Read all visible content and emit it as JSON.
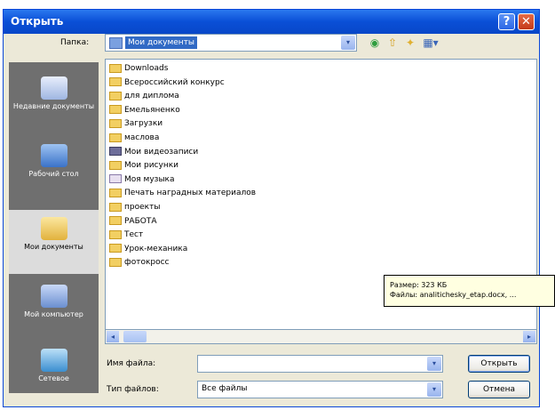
{
  "window": {
    "title": "Открыть",
    "help_glyph": "?",
    "close_glyph": "✕"
  },
  "toolbar": {
    "folder_label": "Папка:",
    "folder_value": "Мои документы",
    "combo_arrow": "▾",
    "back_icon": "back-icon",
    "up_icon": "up-folder-icon",
    "new_folder_icon": "new-folder-icon",
    "views_icon": "views-menu-icon"
  },
  "places": [
    {
      "label": "Недавние документы",
      "icon": "recent-documents-icon"
    },
    {
      "label": "Рабочий стол",
      "icon": "desktop-icon"
    },
    {
      "label": "Мои документы",
      "icon": "my-documents-icon"
    },
    {
      "label": "Мой компьютер",
      "icon": "my-computer-icon"
    },
    {
      "label": "Сетевое",
      "icon": "network-icon"
    }
  ],
  "files": [
    {
      "name": "Downloads",
      "kind": "folder"
    },
    {
      "name": "Всероссийский конкурс",
      "kind": "folder"
    },
    {
      "name": "для диплома",
      "kind": "folder"
    },
    {
      "name": "Емельяненко",
      "kind": "folder"
    },
    {
      "name": "Загрузки",
      "kind": "folder"
    },
    {
      "name": "маслова",
      "kind": "folder"
    },
    {
      "name": "Мои видеозаписи",
      "kind": "video"
    },
    {
      "name": "Мои рисунки",
      "kind": "folder"
    },
    {
      "name": "Моя музыка",
      "kind": "music"
    },
    {
      "name": "Печать наградных материалов",
      "kind": "folder"
    },
    {
      "name": "проекты",
      "kind": "folder"
    },
    {
      "name": "РАБОТА",
      "kind": "folder"
    },
    {
      "name": "Тест",
      "kind": "folder"
    },
    {
      "name": "Урок-механика",
      "kind": "folder"
    },
    {
      "name": "фотокросс",
      "kind": "folder"
    }
  ],
  "tooltip": {
    "line1": "Размер: 323 КБ",
    "line2": "Файлы: analitichesky_etap.docx, ..."
  },
  "bottom": {
    "filename_label": "Имя файла:",
    "filename_value": "",
    "filetype_label": "Тип файлов:",
    "filetype_value": "Все файлы",
    "open_button": "Открыть",
    "cancel_button": "Отмена"
  },
  "scroll": {
    "left_arrow": "◂",
    "right_arrow": "▸"
  },
  "colors": {
    "titlebar": "#0a4fd6",
    "selection": "#316ac5",
    "dialog_bg": "#ece9d8",
    "tooltip_bg": "#ffffe1"
  }
}
